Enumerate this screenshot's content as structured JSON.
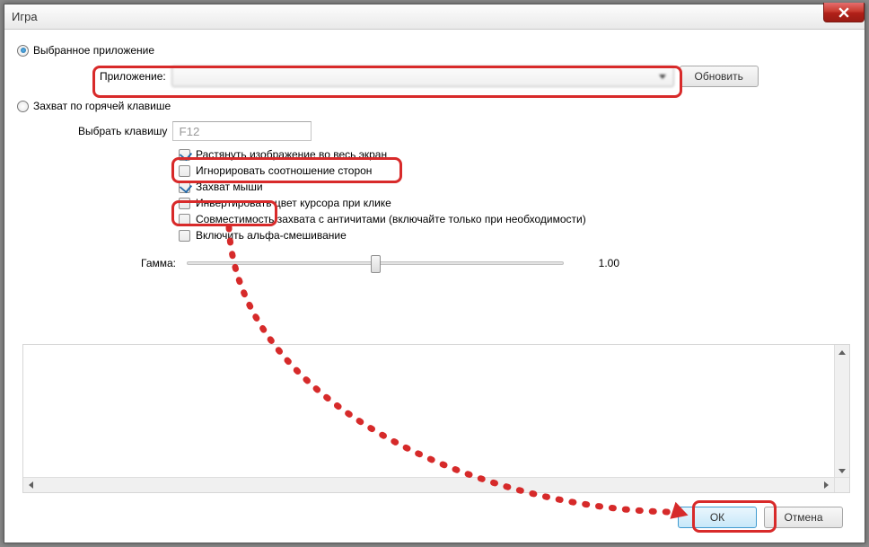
{
  "window": {
    "title": "Игра"
  },
  "modes": {
    "selected_app_label": "Выбранное приложение",
    "hotkey_label": "Захват по горячей клавише"
  },
  "app_row": {
    "label": "Приложение:",
    "refresh_button": "Обновить"
  },
  "key_row": {
    "label": "Выбрать клавишу",
    "value": "F12"
  },
  "options": {
    "stretch": "Растянуть изображение во весь экран",
    "ignore_ratio": "Игнорировать соотношение сторон",
    "capture_mouse": "Захват мыши",
    "invert_cursor": "Инвертировать цвет курсора при клике",
    "anticheat": "Совместимость захвата с античитами (включайте только при необходимости)",
    "alpha": "Включить альфа-смешивание"
  },
  "gamma": {
    "label": "Гамма:",
    "value": "1.00"
  },
  "buttons": {
    "ok": "ОК",
    "cancel": "Отмена"
  }
}
